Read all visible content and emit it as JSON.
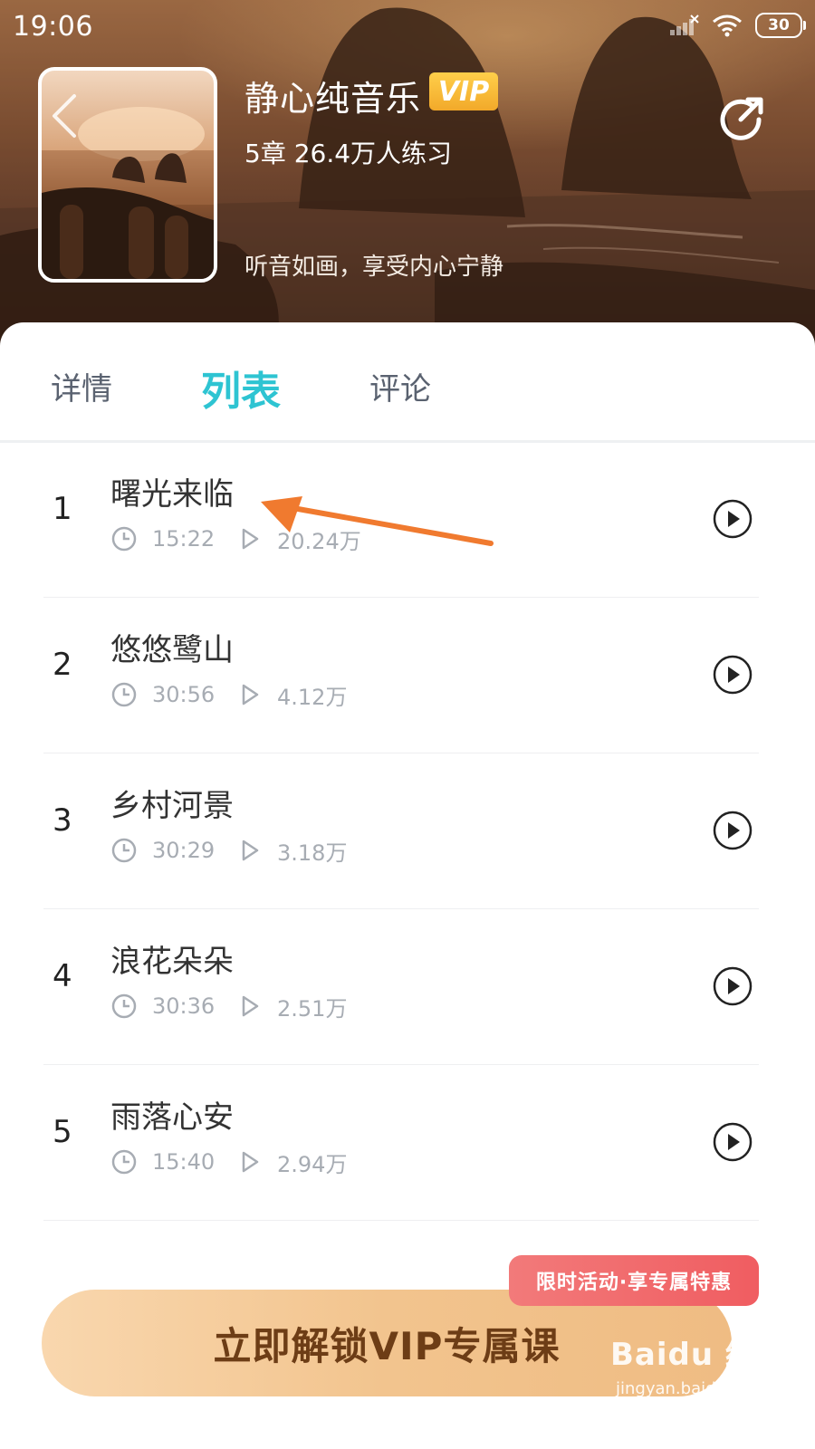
{
  "status_bar": {
    "time": "19:06",
    "battery": "30"
  },
  "header": {
    "title": "静心纯音乐",
    "vip_badge": "VIP",
    "meta": "5章 26.4万人练习",
    "description": "听音如画，享受内心宁静"
  },
  "tabs": [
    {
      "label": "详情",
      "active": false
    },
    {
      "label": "列表",
      "active": true
    },
    {
      "label": "评论",
      "active": false
    }
  ],
  "tracks": [
    {
      "index": "1",
      "title": "曙光来临",
      "duration": "15:22",
      "plays": "20.24万"
    },
    {
      "index": "2",
      "title": "悠悠鹭山",
      "duration": "30:56",
      "plays": "4.12万"
    },
    {
      "index": "3",
      "title": "乡村河景",
      "duration": "30:29",
      "plays": "3.18万"
    },
    {
      "index": "4",
      "title": "浪花朵朵",
      "duration": "30:36",
      "plays": "2.51万"
    },
    {
      "index": "5",
      "title": "雨落心安",
      "duration": "15:40",
      "plays": "2.94万"
    }
  ],
  "promo": {
    "tag": "限时活动·享专属特惠",
    "button": "立即解锁VIP专属课"
  },
  "watermark": {
    "brand": "Baidu 经验",
    "url": "jingyan.baidu.com"
  },
  "colors": {
    "accent": "#2ec4d2",
    "vip": "#f2a92a",
    "promo": "#f05d61",
    "annotation": "#f07a2f"
  }
}
